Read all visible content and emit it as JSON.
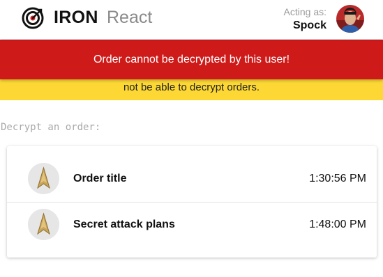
{
  "header": {
    "brand_name": "IRON",
    "brand_suffix": "React",
    "acting_caption": "Acting as:",
    "acting_user": "Spock"
  },
  "error_banner": {
    "message": "Order cannot be decrypted by this user!"
  },
  "warning_banner": {
    "message": "not be able to decrypt orders."
  },
  "section": {
    "title": "Decrypt an order:"
  },
  "orders": [
    {
      "title": "Order title",
      "time": "1:30:56 PM"
    },
    {
      "title": "Secret attack plans",
      "time": "1:48:00 PM"
    }
  ],
  "colors": {
    "error": "#cf1a1a",
    "warning": "#fdd835",
    "brand_dark": "#111111",
    "muted": "#8a8a8a"
  },
  "icons": {
    "brand": "target-logo-icon",
    "avatar": "user-avatar",
    "order": "starfleet-insignia-icon"
  }
}
